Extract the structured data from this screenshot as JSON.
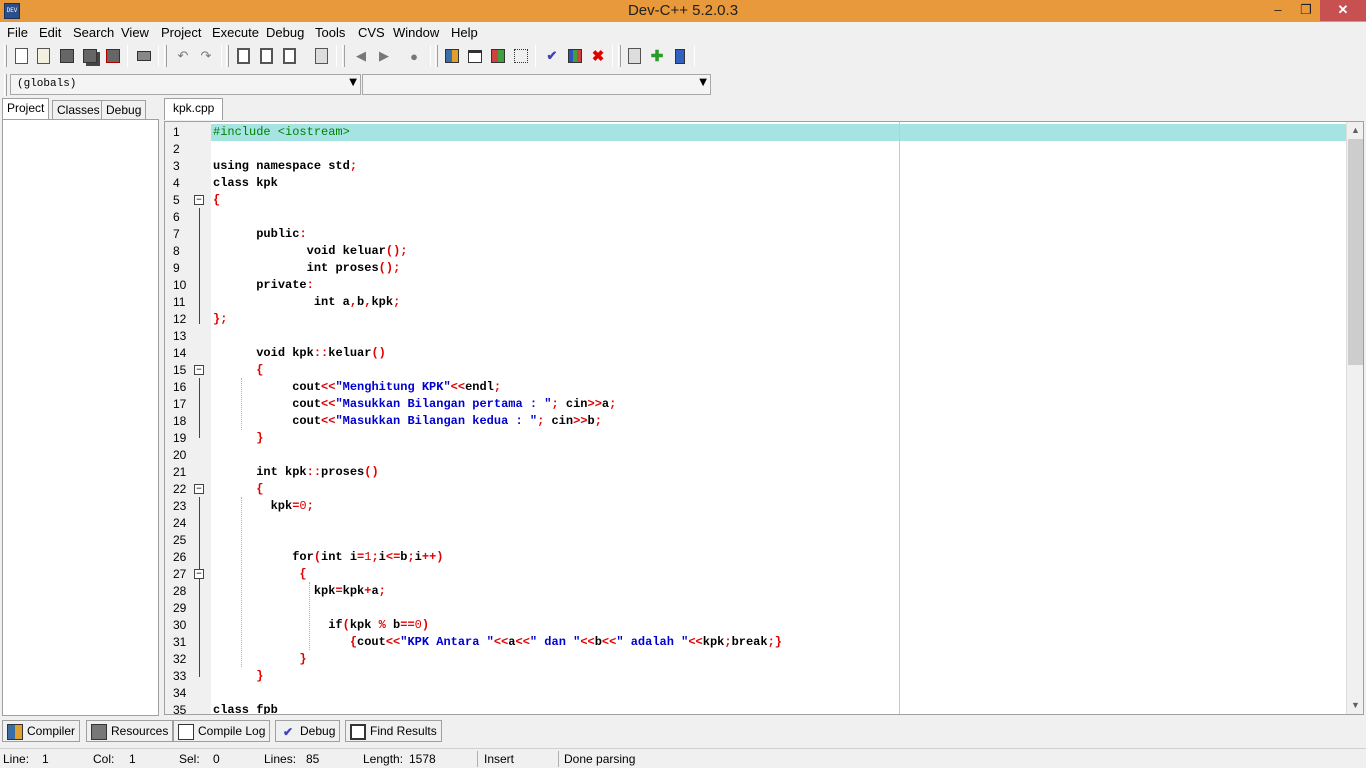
{
  "window": {
    "title": "Dev-C++ 5.2.0.3",
    "icon_text": "DEV",
    "minimize": "‒",
    "restore": "❐",
    "close": "✕"
  },
  "menu": [
    "File",
    "Edit",
    "Search",
    "View",
    "Project",
    "Execute",
    "Debug",
    "Tools",
    "CVS",
    "Window",
    "Help"
  ],
  "toolbar_icons": [
    "new-file-icon",
    "open-file-icon",
    "save-icon",
    "save-all-icon",
    "close-file-icon",
    "print-icon",
    "undo-icon",
    "redo-icon",
    "find-icon",
    "replace-icon",
    "find-next-icon",
    "goto-line-icon",
    "unindent-icon",
    "indent-icon",
    "toggle-comment-icon",
    "new-project-icon",
    "show-window-icon",
    "project-options-icon",
    "class-browser-icon",
    "compile-icon",
    "run-icon",
    "delete-icon",
    "insert-icon",
    "add-file-icon",
    "bookmark-icon"
  ],
  "scope_combo": {
    "value": "(globals)"
  },
  "member_combo": {
    "value": ""
  },
  "left_tabs": [
    "Project",
    "Classes",
    "Debug"
  ],
  "editor_tab": "kpk.cpp",
  "code_lines": [
    "#include <iostream>",
    "",
    "using namespace std;",
    "class kpk",
    "{",
    "",
    "      public:",
    "             void keluar();",
    "             int proses();",
    "      private:",
    "              int a,b,kpk;",
    "};",
    "",
    "      void kpk::keluar()",
    "      {",
    "           cout<<\"Menghitung KPK\"<<endl;",
    "           cout<<\"Masukkan Bilangan pertama : \"; cin>>a;",
    "           cout<<\"Masukkan Bilangan kedua : \"; cin>>b;",
    "      }",
    "",
    "      int kpk::proses()",
    "      {",
    "        kpk=0;",
    "",
    "",
    "           for(int i=1;i<=b;i++)",
    "            {",
    "              kpk=kpk+a;",
    "",
    "                if(kpk % b==0)",
    "                   {cout<<\"KPK Antara \"<<a<<\" dan \"<<b<<\" adalah \"<<kpk;break;}",
    "            }",
    "      }",
    "",
    "class fpb"
  ],
  "line_numbers": [
    "1",
    "2",
    "3",
    "4",
    "5",
    "6",
    "7",
    "8",
    "9",
    "10",
    "11",
    "12",
    "13",
    "14",
    "15",
    "16",
    "17",
    "18",
    "19",
    "20",
    "21",
    "22",
    "23",
    "24",
    "25",
    "26",
    "27",
    "28",
    "29",
    "30",
    "31",
    "32",
    "33",
    "34",
    "35"
  ],
  "fold_markers": {
    "5": "−",
    "15": "−",
    "22": "−",
    "27": "−"
  },
  "bottom_tabs": [
    {
      "label": "Compiler",
      "icon": "compiler-grid-icon"
    },
    {
      "label": "Resources",
      "icon": "resources-icon"
    },
    {
      "label": "Compile Log",
      "icon": "compile-log-icon"
    },
    {
      "label": "Debug",
      "icon": "debug-check-icon"
    },
    {
      "label": "Find Results",
      "icon": "find-results-icon"
    }
  ],
  "status": {
    "line_label": "Line:",
    "line_value": "1",
    "col_label": "Col:",
    "col_value": "1",
    "sel_label": "Sel:",
    "sel_value": "0",
    "lines_label": "Lines:",
    "lines_value": "85",
    "length_label": "Length:",
    "length_value": "1578",
    "mode": "Insert",
    "message": "Done parsing"
  },
  "colors": {
    "titlebar": "#e8993c",
    "current_line": "#a6e4e4",
    "keyword_symbol": "#e00000",
    "string": "#0000d0",
    "preprocessor": "#008000"
  }
}
